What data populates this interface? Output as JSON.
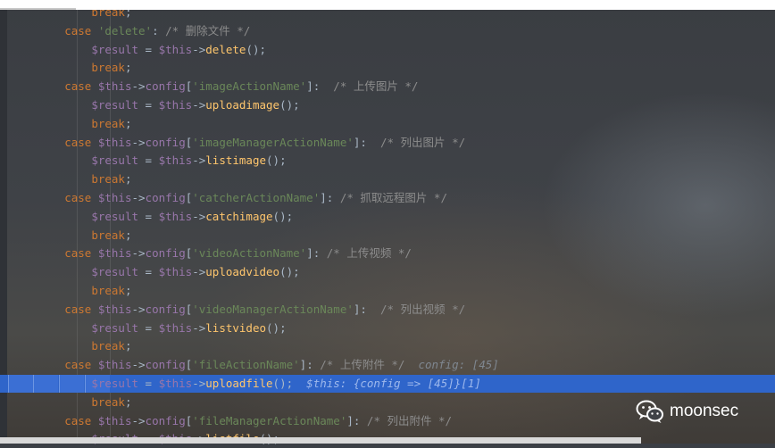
{
  "code_lines": [
    {
      "indent": "            ",
      "tokens": [
        {
          "t": "break",
          "c": "kw"
        },
        {
          "t": ";",
          "c": ""
        }
      ]
    },
    {
      "indent": "        ",
      "tokens": [
        {
          "t": "case ",
          "c": "kw"
        },
        {
          "t": "'delete'",
          "c": "str"
        },
        {
          "t": ": ",
          "c": ""
        },
        {
          "t": "/* 删除文件 */",
          "c": "cmt"
        }
      ]
    },
    {
      "indent": "            ",
      "tokens": [
        {
          "t": "$result",
          "c": "var"
        },
        {
          "t": " = ",
          "c": ""
        },
        {
          "t": "$this",
          "c": "var"
        },
        {
          "t": "->",
          "c": ""
        },
        {
          "t": "delete",
          "c": "fn"
        },
        {
          "t": "();",
          "c": ""
        }
      ]
    },
    {
      "indent": "            ",
      "tokens": [
        {
          "t": "break",
          "c": "kw"
        },
        {
          "t": ";",
          "c": ""
        }
      ]
    },
    {
      "indent": "        ",
      "tokens": [
        {
          "t": "case ",
          "c": "kw"
        },
        {
          "t": "$this",
          "c": "var"
        },
        {
          "t": "->",
          "c": ""
        },
        {
          "t": "config",
          "c": "var"
        },
        {
          "t": "[",
          "c": ""
        },
        {
          "t": "'imageActionName'",
          "c": "str"
        },
        {
          "t": "]:  ",
          "c": ""
        },
        {
          "t": "/* 上传图片 */",
          "c": "cmt"
        }
      ]
    },
    {
      "indent": "            ",
      "tokens": [
        {
          "t": "$result",
          "c": "var"
        },
        {
          "t": " = ",
          "c": ""
        },
        {
          "t": "$this",
          "c": "var"
        },
        {
          "t": "->",
          "c": ""
        },
        {
          "t": "uploadimage",
          "c": "fn"
        },
        {
          "t": "();",
          "c": ""
        }
      ]
    },
    {
      "indent": "            ",
      "tokens": [
        {
          "t": "break",
          "c": "kw"
        },
        {
          "t": ";",
          "c": ""
        }
      ]
    },
    {
      "indent": "        ",
      "tokens": [
        {
          "t": "case ",
          "c": "kw"
        },
        {
          "t": "$this",
          "c": "var"
        },
        {
          "t": "->",
          "c": ""
        },
        {
          "t": "config",
          "c": "var"
        },
        {
          "t": "[",
          "c": ""
        },
        {
          "t": "'imageManagerActionName'",
          "c": "str"
        },
        {
          "t": "]:  ",
          "c": ""
        },
        {
          "t": "/* 列出图片 */",
          "c": "cmt"
        }
      ]
    },
    {
      "indent": "            ",
      "tokens": [
        {
          "t": "$result",
          "c": "var"
        },
        {
          "t": " = ",
          "c": ""
        },
        {
          "t": "$this",
          "c": "var"
        },
        {
          "t": "->",
          "c": ""
        },
        {
          "t": "listimage",
          "c": "fn"
        },
        {
          "t": "();",
          "c": ""
        }
      ]
    },
    {
      "indent": "            ",
      "tokens": [
        {
          "t": "break",
          "c": "kw"
        },
        {
          "t": ";",
          "c": ""
        }
      ]
    },
    {
      "indent": "        ",
      "tokens": [
        {
          "t": "case ",
          "c": "kw"
        },
        {
          "t": "$this",
          "c": "var"
        },
        {
          "t": "->",
          "c": ""
        },
        {
          "t": "config",
          "c": "var"
        },
        {
          "t": "[",
          "c": ""
        },
        {
          "t": "'catcherActionName'",
          "c": "str"
        },
        {
          "t": "]: ",
          "c": ""
        },
        {
          "t": "/* 抓取远程图片 */",
          "c": "cmt"
        }
      ]
    },
    {
      "indent": "            ",
      "tokens": [
        {
          "t": "$result",
          "c": "var"
        },
        {
          "t": " = ",
          "c": ""
        },
        {
          "t": "$this",
          "c": "var"
        },
        {
          "t": "->",
          "c": ""
        },
        {
          "t": "catchimage",
          "c": "fn"
        },
        {
          "t": "();",
          "c": ""
        }
      ]
    },
    {
      "indent": "            ",
      "tokens": [
        {
          "t": "break",
          "c": "kw"
        },
        {
          "t": ";",
          "c": ""
        }
      ]
    },
    {
      "indent": "        ",
      "tokens": [
        {
          "t": "case ",
          "c": "kw"
        },
        {
          "t": "$this",
          "c": "var"
        },
        {
          "t": "->",
          "c": ""
        },
        {
          "t": "config",
          "c": "var"
        },
        {
          "t": "[",
          "c": ""
        },
        {
          "t": "'videoActionName'",
          "c": "str"
        },
        {
          "t": "]: ",
          "c": ""
        },
        {
          "t": "/* 上传视频 */",
          "c": "cmt"
        }
      ]
    },
    {
      "indent": "            ",
      "tokens": [
        {
          "t": "$result",
          "c": "var"
        },
        {
          "t": " = ",
          "c": ""
        },
        {
          "t": "$this",
          "c": "var"
        },
        {
          "t": "->",
          "c": ""
        },
        {
          "t": "uploadvideo",
          "c": "fn"
        },
        {
          "t": "();",
          "c": ""
        }
      ]
    },
    {
      "indent": "            ",
      "tokens": [
        {
          "t": "break",
          "c": "kw"
        },
        {
          "t": ";",
          "c": ""
        }
      ]
    },
    {
      "indent": "        ",
      "tokens": [
        {
          "t": "case ",
          "c": "kw"
        },
        {
          "t": "$this",
          "c": "var"
        },
        {
          "t": "->",
          "c": ""
        },
        {
          "t": "config",
          "c": "var"
        },
        {
          "t": "[",
          "c": ""
        },
        {
          "t": "'videoManagerActionName'",
          "c": "str"
        },
        {
          "t": "]:  ",
          "c": ""
        },
        {
          "t": "/* 列出视频 */",
          "c": "cmt"
        }
      ]
    },
    {
      "indent": "            ",
      "tokens": [
        {
          "t": "$result",
          "c": "var"
        },
        {
          "t": " = ",
          "c": ""
        },
        {
          "t": "$this",
          "c": "var"
        },
        {
          "t": "->",
          "c": ""
        },
        {
          "t": "listvideo",
          "c": "fn"
        },
        {
          "t": "();",
          "c": ""
        }
      ]
    },
    {
      "indent": "            ",
      "tokens": [
        {
          "t": "break",
          "c": "kw"
        },
        {
          "t": ";",
          "c": ""
        }
      ]
    },
    {
      "indent": "        ",
      "tokens": [
        {
          "t": "case ",
          "c": "kw"
        },
        {
          "t": "$this",
          "c": "var"
        },
        {
          "t": "->",
          "c": ""
        },
        {
          "t": "config",
          "c": "var"
        },
        {
          "t": "[",
          "c": ""
        },
        {
          "t": "'fileActionName'",
          "c": "str"
        },
        {
          "t": "]: ",
          "c": ""
        },
        {
          "t": "/* 上传附件 */",
          "c": "cmt"
        },
        {
          "t": "  config: [45]",
          "c": "hint"
        }
      ]
    },
    {
      "indent": "            ",
      "highlight": true,
      "tokens": [
        {
          "t": "$result",
          "c": "var"
        },
        {
          "t": " = ",
          "c": ""
        },
        {
          "t": "$this",
          "c": "var"
        },
        {
          "t": "->",
          "c": ""
        },
        {
          "t": "uploadfile",
          "c": "fn"
        },
        {
          "t": "();",
          "c": ""
        },
        {
          "t": "  $this: {config => [45]}[1]",
          "c": "hint"
        }
      ]
    },
    {
      "indent": "            ",
      "tokens": [
        {
          "t": "break",
          "c": "kw"
        },
        {
          "t": ";",
          "c": ""
        }
      ]
    },
    {
      "indent": "        ",
      "tokens": [
        {
          "t": "case ",
          "c": "kw"
        },
        {
          "t": "$this",
          "c": "var"
        },
        {
          "t": "->",
          "c": ""
        },
        {
          "t": "config",
          "c": "var"
        },
        {
          "t": "[",
          "c": ""
        },
        {
          "t": "'fileManagerActionName'",
          "c": "str"
        },
        {
          "t": "]: ",
          "c": ""
        },
        {
          "t": "/* 列出附件 */",
          "c": "cmt"
        }
      ]
    },
    {
      "indent": "            ",
      "tokens": [
        {
          "t": "$result",
          "c": "var"
        },
        {
          "t": " = ",
          "c": ""
        },
        {
          "t": "$this",
          "c": "var"
        },
        {
          "t": "->",
          "c": ""
        },
        {
          "t": "listfile",
          "c": "fn"
        },
        {
          "t": "();",
          "c": ""
        }
      ]
    }
  ],
  "watermark": {
    "label": "moonsec",
    "icon": "wechat-icon"
  },
  "colors": {
    "keyword": "#cc7832",
    "variable": "#9876aa",
    "function": "#ffc66d",
    "string": "#6a8759",
    "comment": "#8c8c8c",
    "highlight_line": "#2f65ca"
  }
}
